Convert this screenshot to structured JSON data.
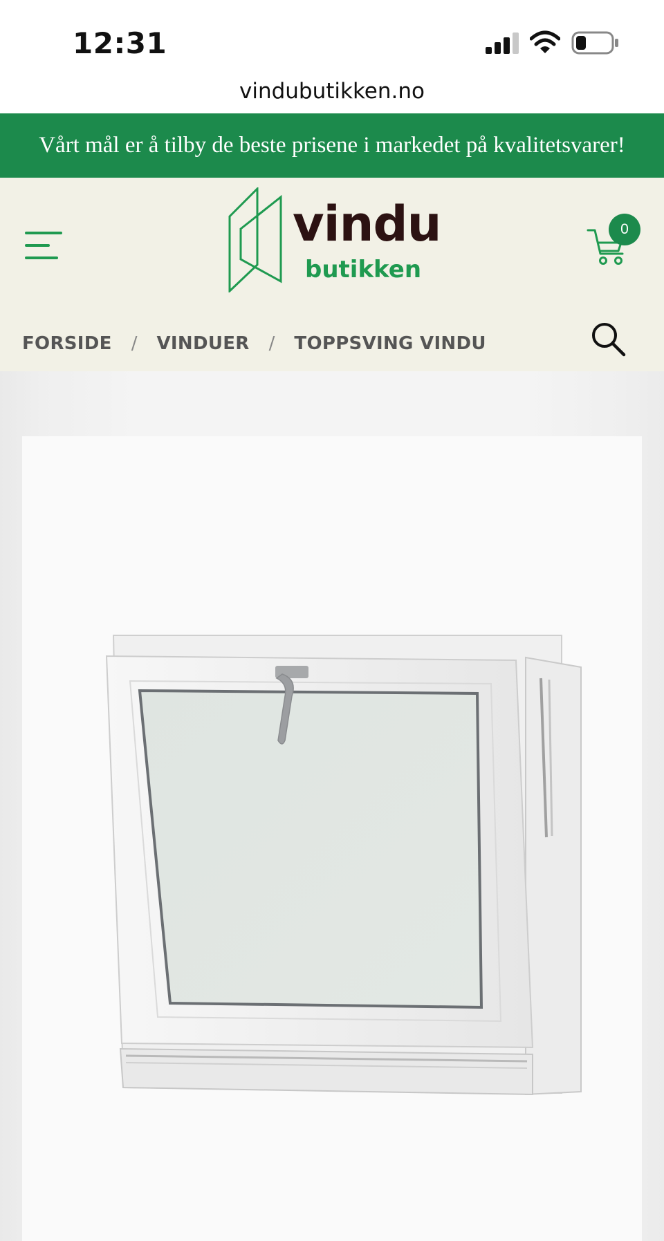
{
  "status_bar": {
    "time": "12:31",
    "icons": [
      "signal-icon",
      "wifi-icon",
      "battery-icon"
    ]
  },
  "browser": {
    "url": "vindubutikken.no"
  },
  "promo": {
    "text": "Vårt mål er å tilby de beste prisene i markedet på kvalitetsvarer!",
    "background": "#1c8a4c"
  },
  "header": {
    "logo": {
      "line1": "vindu",
      "line2": "butikken"
    },
    "cart_count": "0",
    "menu_icon": "hamburger-menu-icon",
    "cart_icon": "shopping-cart-icon",
    "search_icon": "search-icon",
    "background": "#f2f1e6",
    "accent": "#1f9a50"
  },
  "breadcrumb": {
    "items": [
      "FORSIDE",
      "VINDUER",
      "TOPPSVING VINDU"
    ],
    "separator": "/"
  },
  "product": {
    "image": "top-hung-window-product-photo"
  }
}
